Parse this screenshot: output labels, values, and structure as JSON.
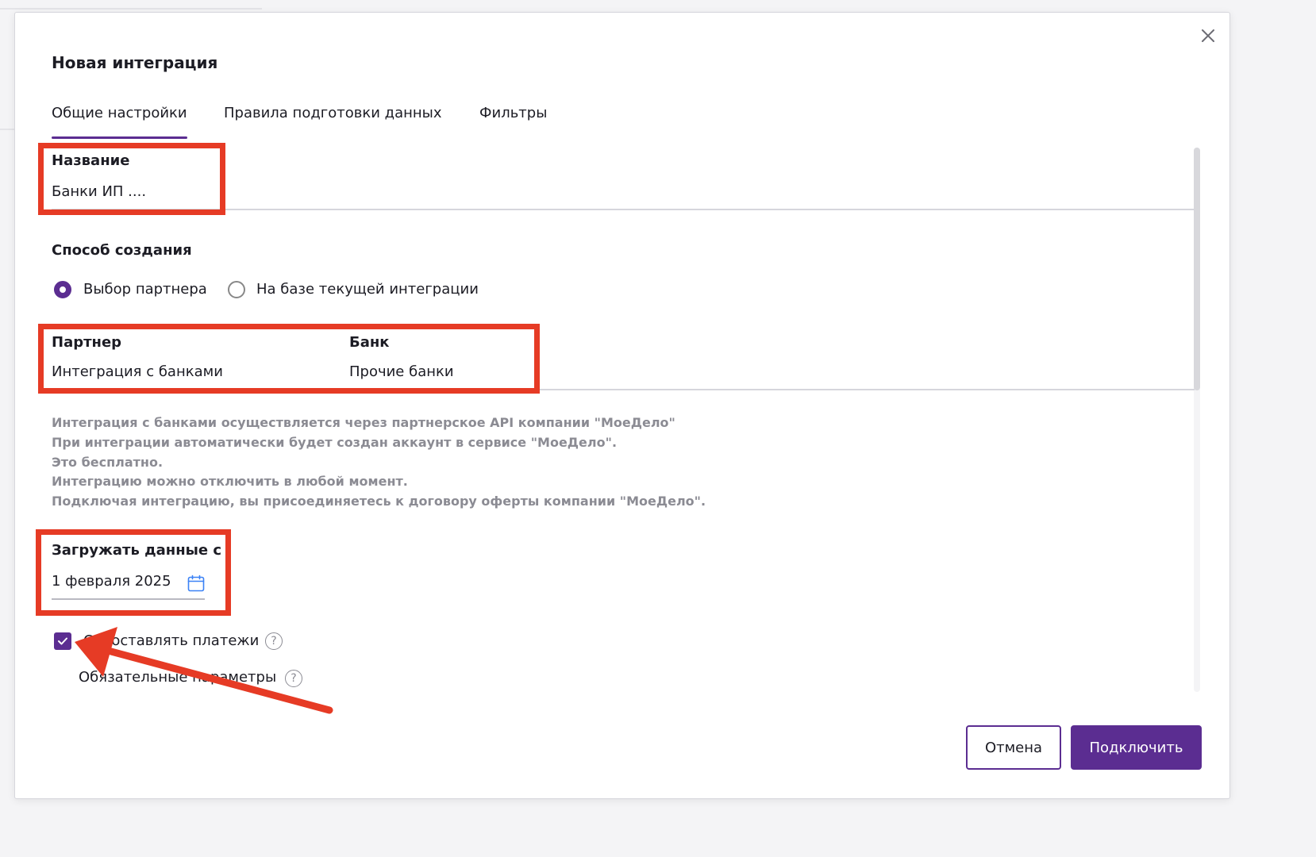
{
  "dialog": {
    "title": "Новая интеграция",
    "tabs": [
      {
        "label": "Общие настройки",
        "active": true
      },
      {
        "label": "Правила подготовки данных",
        "active": false
      },
      {
        "label": "Фильтры",
        "active": false
      }
    ]
  },
  "name_field": {
    "label": "Название",
    "value": "Банки ИП ...."
  },
  "creation_method": {
    "label": "Способ создания",
    "options": [
      {
        "label": "Выбор партнера",
        "checked": true
      },
      {
        "label": "На базе текущей интеграции",
        "checked": false
      }
    ]
  },
  "partner_field": {
    "label": "Партнер",
    "value": "Интеграция с банками"
  },
  "bank_field": {
    "label": "Банк",
    "value": "Прочие банки"
  },
  "info_lines": [
    "Интеграция с банками осуществляется через партнерское API компании \"МоеДело\"",
    "При интеграции автоматически будет создан аккаунт в сервисе \"МоеДело\".",
    "Это бесплатно.",
    "Интеграцию можно отключить в любой момент.",
    "Подключая интеграцию, вы присоединяетесь к договору оферты компании \"МоеДело\"."
  ],
  "load_from": {
    "label": "Загружать данные с",
    "value": "1 февраля 2025",
    "icon": "calendar-icon"
  },
  "match_payments": {
    "label": "Сопоставлять платежи",
    "checked": true,
    "help_glyph": "?"
  },
  "required_params": {
    "label": "Обязательные параметры",
    "help_glyph": "?"
  },
  "actions": {
    "cancel": "Отмена",
    "connect": "Подключить"
  },
  "colors": {
    "accent": "#5b2d91",
    "annotation": "#e63b25",
    "muted_text": "#8b8b93"
  }
}
